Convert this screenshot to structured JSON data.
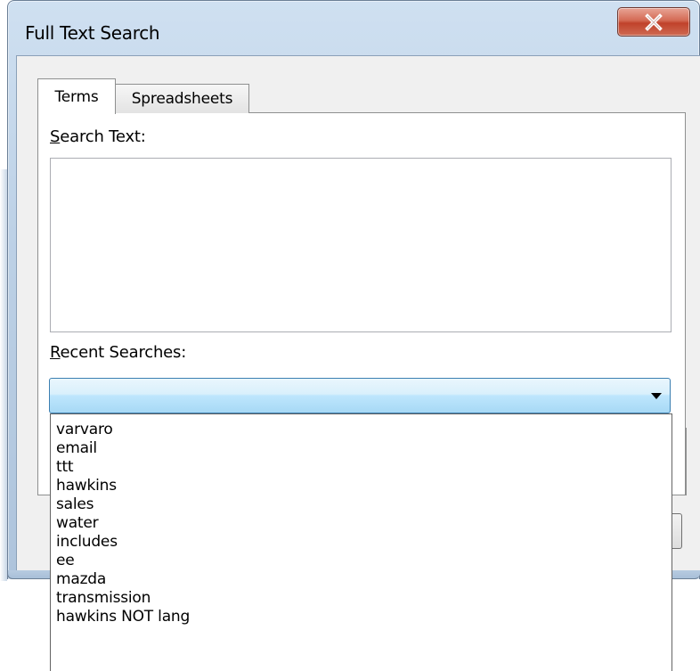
{
  "window": {
    "title": "Full Text Search",
    "close_icon": "close-icon"
  },
  "tabs": [
    {
      "label": "Terms",
      "selected": true
    },
    {
      "label": "Spreadsheets",
      "selected": false
    }
  ],
  "search_text": {
    "label_accel": "S",
    "label_rest": "earch Text:",
    "value": ""
  },
  "recent_searches": {
    "label_accel": "R",
    "label_rest": "ecent Searches:",
    "selected_value": "",
    "options": [
      "varvaro",
      "email",
      "ttt",
      "hawkins",
      "sales",
      "water",
      "includes",
      "ee",
      "mazda",
      "transmission",
      "hawkins NOT lang"
    ]
  },
  "colors": {
    "title_bar": "#bdd1e6",
    "close_button": "#c0422b",
    "combo_selected": "#a7d9f5"
  }
}
